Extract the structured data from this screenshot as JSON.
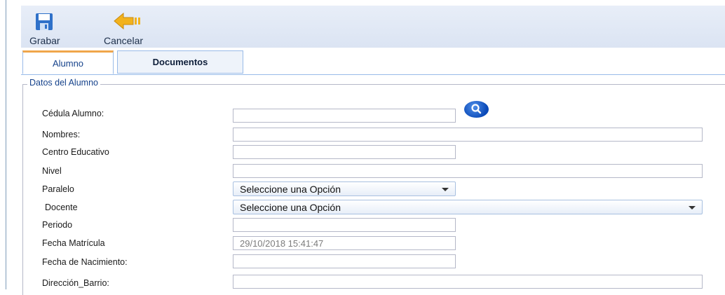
{
  "toolbar": {
    "save_label": "Grabar",
    "cancel_label": "Cancelar",
    "save_icon": "floppy-disk-icon",
    "cancel_icon": "back-arrow-icon"
  },
  "tabs": [
    {
      "label": "Alumno",
      "active": true
    },
    {
      "label": "Documentos",
      "active": false
    }
  ],
  "section": {
    "legend": "Datos del Alumno"
  },
  "form": {
    "cedula_label": "Cédula Alumno:",
    "cedula_value": "",
    "nombres_label": "Nombres:",
    "nombres_value": "",
    "centro_label": "Centro Educativo",
    "centro_value": "",
    "nivel_label": "Nivel",
    "nivel_value": "",
    "paralelo_label": "Paralelo",
    "paralelo_value": "Seleccione una Opción",
    "docente_label": "Docente",
    "docente_value": "Seleccione una Opción",
    "periodo_label": "Periodo",
    "periodo_value": "",
    "fecha_matricula_label": "Fecha Matrícula",
    "fecha_matricula_value": "29/10/2018 15:41:47",
    "fecha_nacimiento_label": "Fecha de Nacimiento:",
    "fecha_nacimiento_value": "",
    "direccion_label": "Dirección_Barrio:",
    "direccion_value": "",
    "search_icon": "search-icon"
  },
  "colors": {
    "accent": "#15428b",
    "tab_highlight": "#f0a64b",
    "search_button": "#0a49b8"
  }
}
